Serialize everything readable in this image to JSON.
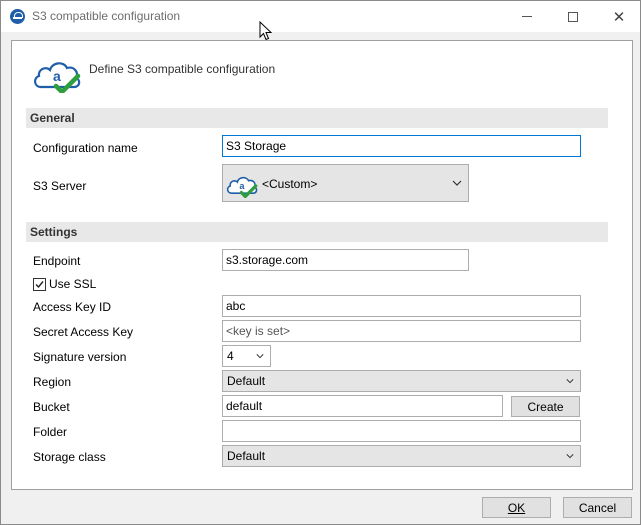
{
  "window": {
    "title": "S3 compatible configuration",
    "controls": {
      "minimize": "minimize",
      "maximize": "maximize",
      "close": "✕"
    }
  },
  "header": {
    "text": "Define S3 compatible configuration"
  },
  "general": {
    "heading": "General",
    "configuration_name": {
      "label": "Configuration name",
      "value": "S3 Storage"
    },
    "s3_server": {
      "label": "S3 Server",
      "value": "<Custom>"
    }
  },
  "settings": {
    "heading": "Settings",
    "endpoint": {
      "label": "Endpoint",
      "value": "s3.storage.com"
    },
    "use_ssl": {
      "label": "Use SSL",
      "checked": true
    },
    "access_key_id": {
      "label": "Access Key ID",
      "value": "abc"
    },
    "secret_access_key": {
      "label": "Secret Access Key",
      "value": "<key is set>"
    },
    "signature_version": {
      "label": "Signature version",
      "value": "4"
    },
    "region": {
      "label": "Region",
      "value": "Default"
    },
    "bucket": {
      "label": "Bucket",
      "value": "default",
      "create_label": "Create"
    },
    "folder": {
      "label": "Folder",
      "value": ""
    },
    "storage_class": {
      "label": "Storage class",
      "value": "Default"
    }
  },
  "footer": {
    "ok_label": "OK",
    "cancel_label": "Cancel"
  },
  "colors": {
    "accent": "#0078d7",
    "logo_blue": "#1e5fa8",
    "logo_green": "#2e9e3e"
  },
  "icons": [
    "app-icon",
    "cloud-logo-icon",
    "checkmark-icon",
    "chevron-down-icon",
    "mouse-cursor-icon"
  ]
}
